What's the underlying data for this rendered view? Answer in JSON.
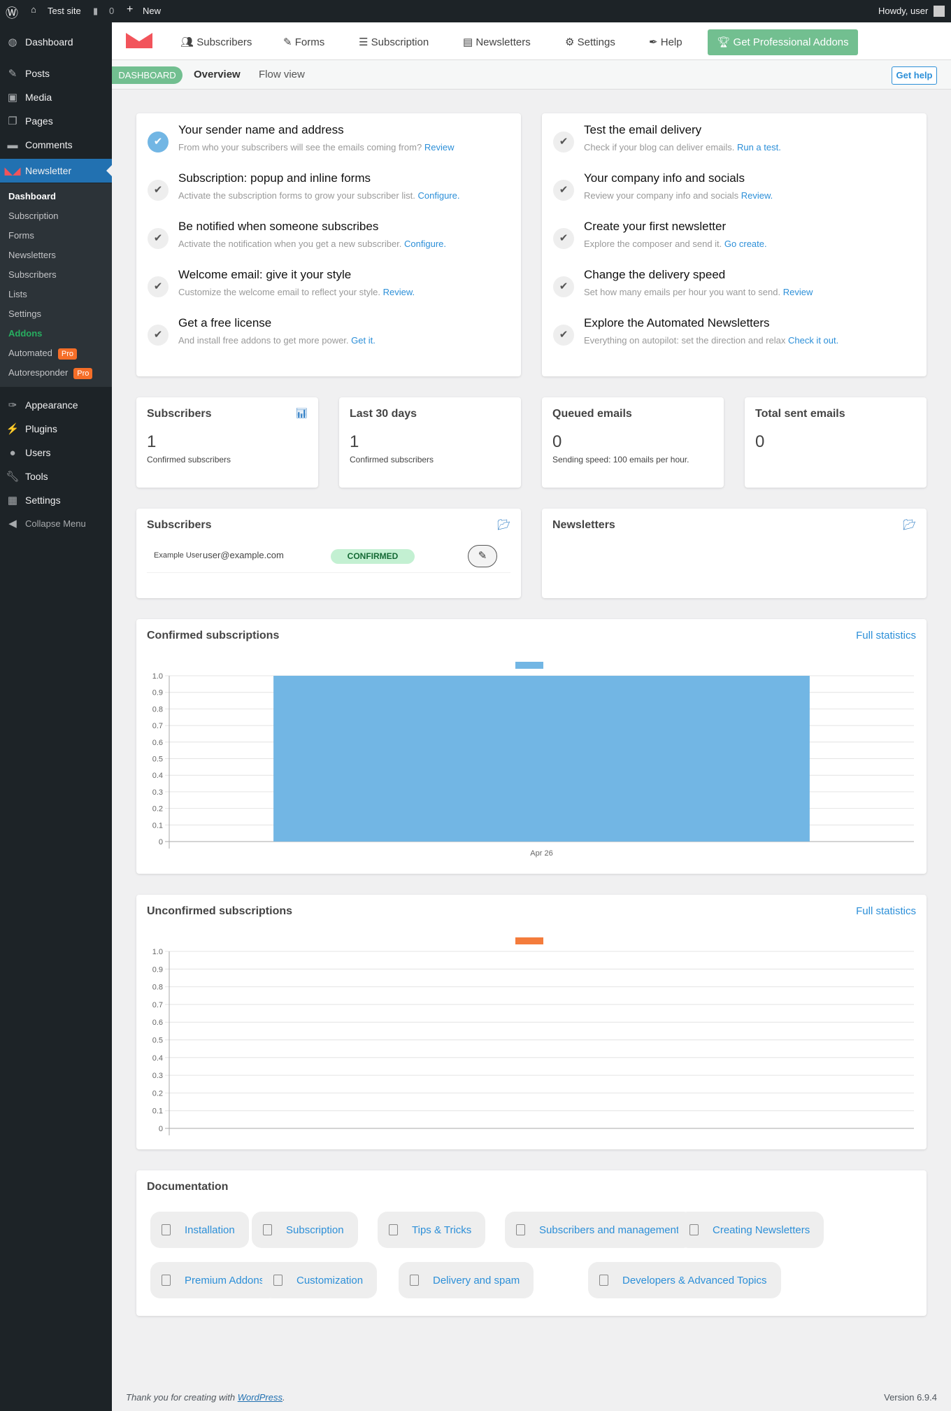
{
  "topbar": {
    "site": "Test site",
    "comments": "0",
    "new": "New",
    "howdy": "Howdy, user"
  },
  "sidebar": {
    "items": [
      {
        "label": "Dashboard",
        "icon": "dashboard-icon"
      },
      {
        "label": "Posts",
        "icon": "pin-icon"
      },
      {
        "label": "Media",
        "icon": "media-icon"
      },
      {
        "label": "Pages",
        "icon": "pages-icon"
      },
      {
        "label": "Comments",
        "icon": "comment-icon"
      },
      {
        "label": "Newsletter",
        "icon": "newsletter-icon"
      }
    ],
    "submenu": [
      "Dashboard",
      "Subscription",
      "Forms",
      "Newsletters",
      "Subscribers",
      "Lists",
      "Settings",
      "Addons",
      "Automated",
      "Autoresponder"
    ],
    "pro_badge": "Pro",
    "lower": [
      {
        "label": "Appearance",
        "icon": "brush-icon"
      },
      {
        "label": "Plugins",
        "icon": "plug-icon"
      },
      {
        "label": "Users",
        "icon": "user-icon"
      },
      {
        "label": "Tools",
        "icon": "wrench-icon"
      },
      {
        "label": "Settings",
        "icon": "settings-icon"
      }
    ],
    "collapse": "Collapse Menu"
  },
  "nav": {
    "items": [
      "Subscribers",
      "Forms",
      "Subscription",
      "Newsletters",
      "Settings",
      "Help"
    ],
    "cta": "Get Professional Addons",
    "cta_color": "#72bf90"
  },
  "subnav": {
    "pill": "DASHBOARD",
    "overview": "Overview",
    "flow": "Flow view",
    "help": "Get help"
  },
  "checklist_left": [
    {
      "title": "Your sender name and address",
      "desc": "From who your subscribers will see the emails coming from?",
      "link": "Review",
      "done": true
    },
    {
      "title": "Subscription: popup and inline forms",
      "desc": "Activate the subscription forms to grow your subscriber list.",
      "link": "Configure."
    },
    {
      "title": "Be notified when someone subscribes",
      "desc": "Activate the notification when you get a new subscriber.",
      "link": "Configure."
    },
    {
      "title": "Welcome email: give it your style",
      "desc": "Customize the welcome email to reflect your style.",
      "link": "Review."
    },
    {
      "title": "Get a free license",
      "desc": "And install free addons to get more power.",
      "link": "Get it."
    }
  ],
  "checklist_right": [
    {
      "title": "Test the email delivery",
      "desc": "Check if your blog can deliver emails.",
      "link": "Run a test."
    },
    {
      "title": "Your company info and socials",
      "desc": "Review your company info and socials",
      "link": "Review."
    },
    {
      "title": "Create your first newsletter",
      "desc": "Explore the composer and send it.",
      "link": "Go create."
    },
    {
      "title": "Change the delivery speed",
      "desc": "Set how many emails per hour you want to send.",
      "link": "Review"
    },
    {
      "title": "Explore the Automated Newsletters",
      "desc": "Everything on autopilot: set the direction and relax",
      "link": "Check it out."
    }
  ],
  "stats": [
    {
      "title": "Subscribers",
      "value": "1",
      "sub": "Confirmed subscribers"
    },
    {
      "title": "Last 30 days",
      "value": "1",
      "sub": "Confirmed subscribers"
    },
    {
      "title": "Queued emails",
      "value": "0",
      "sub": "Sending speed: 100 emails per hour."
    },
    {
      "title": "Total sent emails",
      "value": "0",
      "sub": ""
    }
  ],
  "subscribers_card": {
    "title": "Subscribers",
    "name": "Example User",
    "email": "user@example.com",
    "status": "CONFIRMED"
  },
  "newsletters_card": {
    "title": "Newsletters"
  },
  "full_stats": "Full statistics",
  "chart_data": [
    {
      "type": "bar",
      "title": "Confirmed subscriptions",
      "categories": [
        "Apr 26"
      ],
      "values": [
        1
      ],
      "ylim": [
        0,
        1
      ],
      "yticks": [
        "0",
        "0.1",
        "0.2",
        "0.3",
        "0.4",
        "0.5",
        "0.6",
        "0.7",
        "0.8",
        "0.9",
        "1.0"
      ],
      "color": "#72b6e4",
      "grid": true,
      "legend": "top"
    },
    {
      "type": "bar",
      "title": "Unconfirmed subscriptions",
      "categories": [],
      "values": [],
      "ylim": [
        0,
        1
      ],
      "yticks": [
        "0",
        "0.1",
        "0.2",
        "0.3",
        "0.4",
        "0.5",
        "0.6",
        "0.7",
        "0.8",
        "0.9",
        "1.0"
      ],
      "color": "#f47c3c",
      "grid": true,
      "legend": "top"
    }
  ],
  "docs": {
    "title": "Documentation",
    "items": [
      "Installation",
      "Subscription",
      "Tips & Tricks",
      "Subscribers and management",
      "Creating Newsletters",
      "Premium Addons",
      "Customization",
      "Delivery and spam",
      "Developers & Advanced Topics"
    ]
  },
  "footer": {
    "thanks": "Thank you for creating with",
    "wp": "WordPress",
    "version": "Version 6.9.4"
  }
}
